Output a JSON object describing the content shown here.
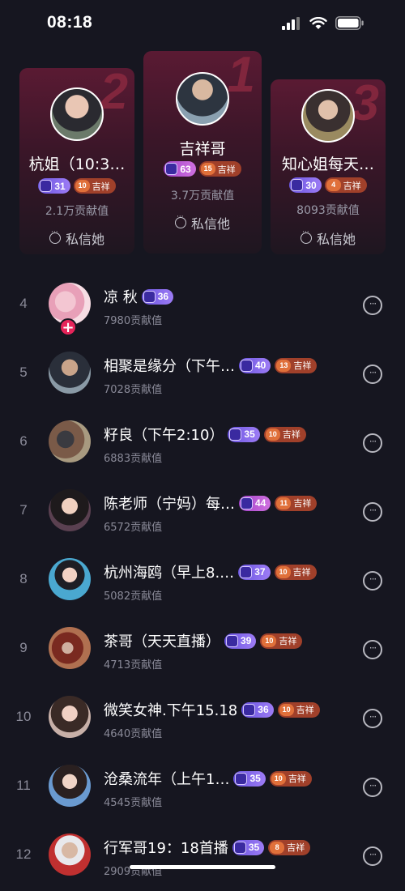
{
  "status_bar": {
    "time": "08:18"
  },
  "podium": [
    {
      "rank": "2",
      "name": "杭姐（10:3…",
      "level": "31",
      "fan_level": "10",
      "fan_label": "吉祥",
      "contribution": "2.1万贡献值",
      "message": "私信她"
    },
    {
      "rank": "1",
      "name": "吉祥哥",
      "level": "63",
      "fan_level": "15",
      "fan_label": "吉祥",
      "contribution": "3.7万贡献值",
      "message": "私信他"
    },
    {
      "rank": "3",
      "name": "知心姐每天…",
      "level": "30",
      "fan_level": "4",
      "fan_label": "吉祥",
      "contribution": "8093贡献值",
      "message": "私信她"
    }
  ],
  "list": [
    {
      "rank": "4",
      "name": "凉 秋",
      "level": "36",
      "fan_level": "",
      "fan_label": "",
      "contribution": "7980贡献值"
    },
    {
      "rank": "5",
      "name": "相聚是缘分（下午…",
      "level": "40",
      "fan_level": "13",
      "fan_label": "吉祥",
      "contribution": "7028贡献值"
    },
    {
      "rank": "6",
      "name": "籽良（下午2:10）",
      "level": "35",
      "fan_level": "10",
      "fan_label": "吉祥",
      "contribution": "6883贡献值"
    },
    {
      "rank": "7",
      "name": "陈老师（宁妈）每…",
      "level": "44",
      "fan_level": "11",
      "fan_label": "吉祥",
      "contribution": "6572贡献值"
    },
    {
      "rank": "8",
      "name": "杭州海鸥（早上8.…",
      "level": "37",
      "fan_level": "10",
      "fan_label": "吉祥",
      "contribution": "5082贡献值"
    },
    {
      "rank": "9",
      "name": "茶哥（天天直播）",
      "level": "39",
      "fan_level": "10",
      "fan_label": "吉祥",
      "contribution": "4713贡献值"
    },
    {
      "rank": "10",
      "name": "微笑女神.下午15.18",
      "level": "36",
      "fan_level": "10",
      "fan_label": "吉祥",
      "contribution": "4640贡献值"
    },
    {
      "rank": "11",
      "name": "沧桑流年（上午1…",
      "level": "35",
      "fan_level": "10",
      "fan_label": "吉祥",
      "contribution": "4545贡献值"
    },
    {
      "rank": "12",
      "name": "行军哥19：18首播",
      "level": "35",
      "fan_level": "8",
      "fan_label": "吉祥",
      "contribution": "2909贡献值"
    }
  ],
  "add_follow": "+"
}
